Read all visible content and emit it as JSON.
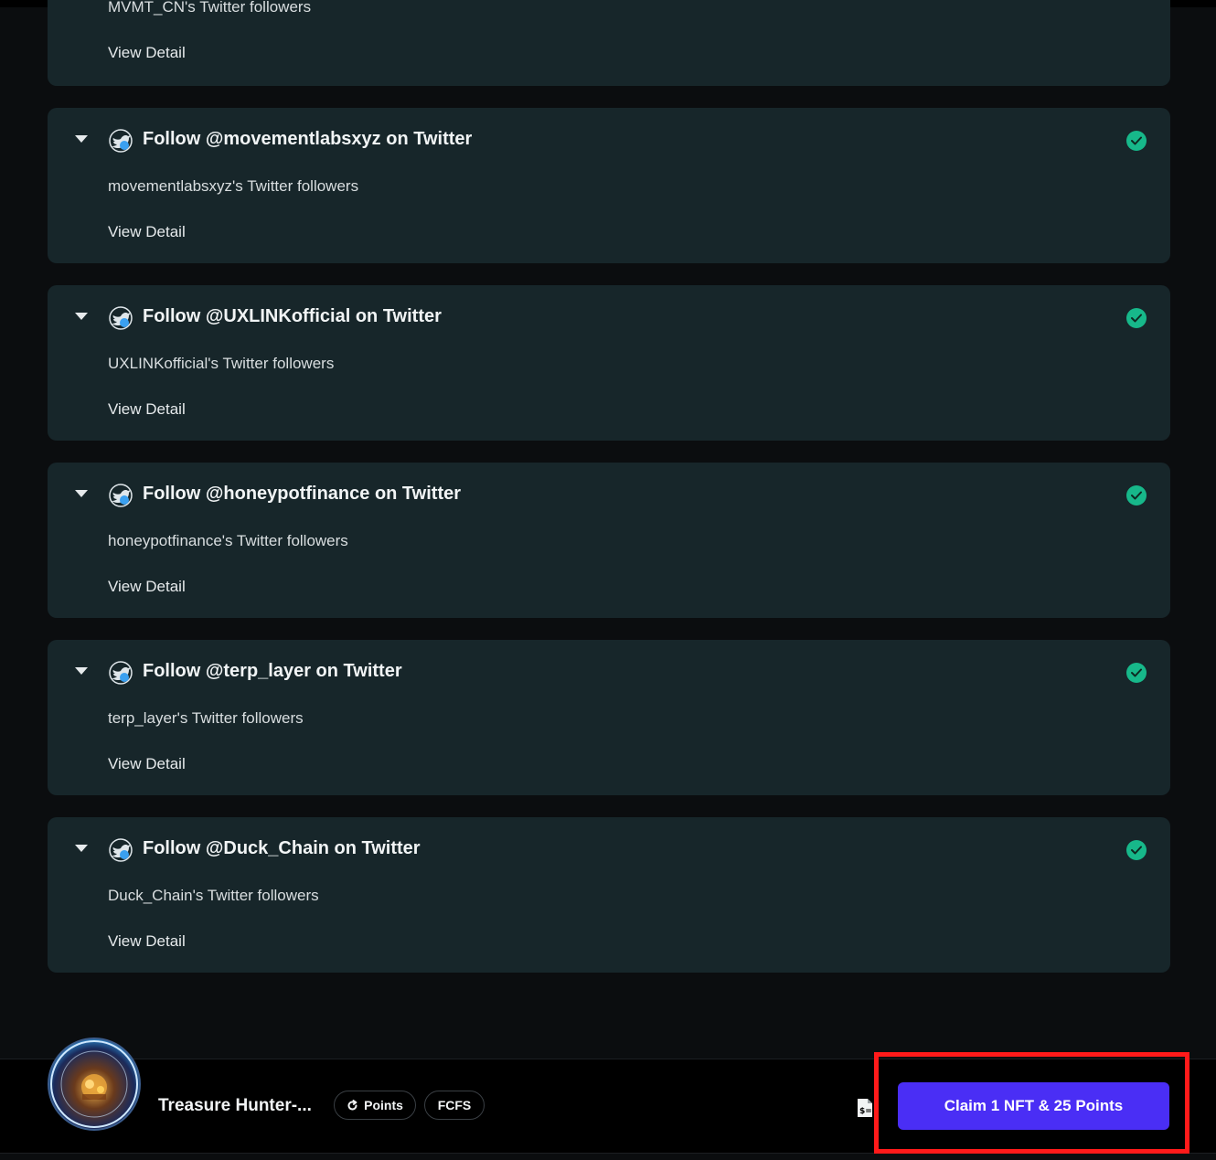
{
  "partial_task": {
    "description": "MVMT_CN's Twitter followers",
    "view_detail": "View Detail"
  },
  "tasks": [
    {
      "title": "Follow @movementlabsxyz on Twitter",
      "description": "movementlabsxyz's Twitter followers",
      "view_detail": "View Detail",
      "completed": true
    },
    {
      "title": "Follow @UXLINKofficial on Twitter",
      "description": "UXLINKofficial's Twitter followers",
      "view_detail": "View Detail",
      "completed": true
    },
    {
      "title": "Follow @honeypotfinance on Twitter",
      "description": "honeypotfinance's Twitter followers",
      "view_detail": "View Detail",
      "completed": true
    },
    {
      "title": "Follow @terp_layer on Twitter",
      "description": "terp_layer's Twitter followers",
      "view_detail": "View Detail",
      "completed": true
    },
    {
      "title": "Follow @Duck_Chain on Twitter",
      "description": "Duck_Chain's Twitter followers",
      "view_detail": "View Detail",
      "completed": true
    }
  ],
  "bottom_bar": {
    "project_name": "Treasure Hunter-...",
    "tags": [
      "Points",
      "FCFS"
    ],
    "claim_label": "Claim 1 NFT & 25 Points"
  },
  "colors": {
    "card_bg": "#17262a",
    "page_bg": "#0b0d0f",
    "check_green": "#17b88a",
    "claim_purple": "#4a2ef5",
    "highlight_red": "#ff1a1a"
  },
  "icons": {
    "task": "twitter-bird-icon",
    "expand": "chevron-down-icon",
    "status": "check-circle-icon",
    "points_tag": "refresh-icon",
    "document": "document-dollar-icon"
  }
}
